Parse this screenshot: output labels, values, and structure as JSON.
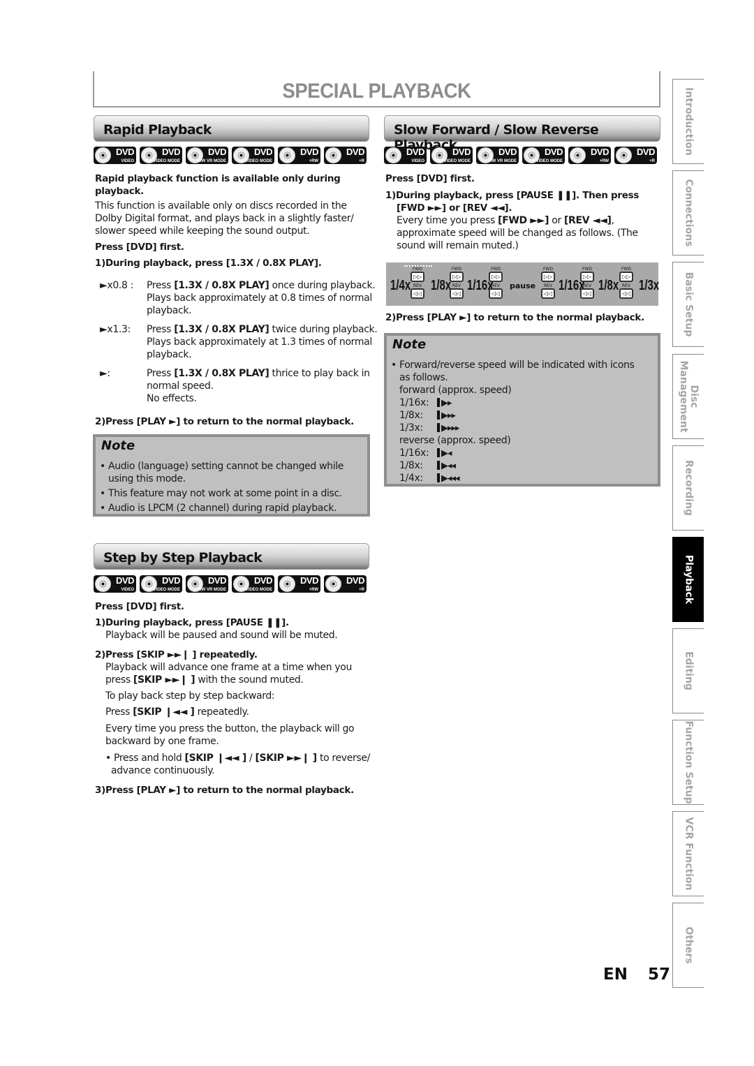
{
  "page": {
    "title": "SPECIAL PLAYBACK",
    "lang_code": "EN",
    "page_number": "57"
  },
  "disc_icons": [
    {
      "name": "DVD",
      "sub": "VIDEO"
    },
    {
      "name": "DVD",
      "sub": "-RW VIDEO MODE"
    },
    {
      "name": "DVD",
      "sub": "-RW VR MODE"
    },
    {
      "name": "DVD",
      "sub": "-R VIDEO MODE"
    },
    {
      "name": "DVD",
      "sub": "+RW"
    },
    {
      "name": "DVD",
      "sub": "+R"
    }
  ],
  "rapid": {
    "header": "Rapid Playback",
    "intro_bold_1": "Rapid playback function is available only during",
    "intro_bold_2": "playback.",
    "desc_1": "This function is available only on discs recorded in the",
    "desc_2": "Dolby Digital format, and plays back in a slightly faster/",
    "desc_3": "slower speed while keeping the sound output.",
    "press_first": "Press [DVD] first.",
    "step1": "1)During playback, press [1.3X / 0.8X PLAY].",
    "modes": [
      {
        "key": "►x0.8 :",
        "pre": "Press ",
        "btn": "[1.3X / 0.8X PLAY]",
        "post": " once during playback.",
        "l2": "Plays back approximately at 0.8 times of normal",
        "l3": "playback."
      },
      {
        "key": "►x1.3:",
        "pre": "Press ",
        "btn": "[1.3X / 0.8X PLAY]",
        "post": " twice during playback.",
        "l2": "Plays back approximately at 1.3 times of normal",
        "l3": "playback."
      },
      {
        "key": "►:",
        "pre": "Press ",
        "btn": "[1.3X / 0.8X PLAY]",
        "post": " thrice to play back in",
        "l2": "normal speed.",
        "l3": "No effects."
      }
    ],
    "step2": "2)Press [PLAY ►] to return to the normal playback.",
    "note_title": "Note",
    "notes": [
      "Audio (language) setting cannot be changed while",
      "using this mode.",
      "This feature may not work at some point in a disc.",
      "Audio is LPCM (2 channel) during rapid playback."
    ]
  },
  "slow": {
    "header": "Slow Forward / Slow Reverse Playback",
    "press_first": "Press [DVD] first.",
    "step1_a": "1)During playback, press [PAUSE ❚❚]. Then press",
    "step1_b": "[FWD ►►] or [REV ◄◄].",
    "desc_pre": "Every time you press ",
    "desc_fwd": "[FWD ►►]",
    "desc_or": " or ",
    "desc_rev": "[REV ◄◄]",
    "desc_comma": ",",
    "desc_2": "approximate speed will be changed as follows. (The",
    "desc_3": "sound will remain muted.)",
    "diagram": {
      "speeds": [
        "1/4x",
        "1/8x",
        "1/16x",
        "pause",
        "1/16x",
        "1/8x",
        "1/3x"
      ],
      "fwd_label": "FWD",
      "rev_label": "REV",
      "fwd_glyph": "▷▷",
      "rev_glyph": "◁◁"
    },
    "step2": "2)Press [PLAY ►] to return to the normal playback.",
    "note_title": "Note",
    "note_line1": "Forward/reverse speed will be indicated with icons",
    "note_line2": "as follows.",
    "forward_label": "forward (approx. speed)",
    "forward_speeds": [
      {
        "label": "1/16x:",
        "icon": "▶▸"
      },
      {
        "label": "1/8x:",
        "icon": "▶▸▸"
      },
      {
        "label": "1/3x:",
        "icon": "▶▸▸▸"
      }
    ],
    "reverse_label": "reverse (approx. speed)",
    "reverse_speeds": [
      {
        "label": "1/16x:",
        "icon": "▶◂"
      },
      {
        "label": "1/8x:",
        "icon": "▶◂◂"
      },
      {
        "label": "1/4x:",
        "icon": "▶◂◂◂"
      }
    ]
  },
  "step": {
    "header": "Step by Step Playback",
    "press_first": "Press [DVD] first.",
    "step1": "1)During playback, press [PAUSE ❚❚].",
    "step1_desc": "Playback will be paused and sound will be muted.",
    "step2": "2)Press [SKIP ►►❙ ] repeatedly.",
    "step2_desc1": "Playback will advance one frame at a time when you",
    "step2_desc2_pre": "press ",
    "step2_desc2_btn": "[SKIP ►►❙ ]",
    "step2_desc2_post": " with the sound muted.",
    "backward_intro": "To play back step by step backward:",
    "backward_pre": "Press ",
    "backward_btn": "[SKIP ❙◄◄ ]",
    "backward_post": " repeatedly.",
    "every_1": "Every time you press the button, the playback will go",
    "every_2": "backward by one frame.",
    "hold_pre": "Press and hold ",
    "hold_btn1": "[SKIP ❙◄◄ ]",
    "hold_mid": " / ",
    "hold_btn2": "[SKIP ►►❙ ]",
    "hold_post": " to reverse/",
    "hold_2": "advance continuously.",
    "step3": "3)Press [PLAY ►] to return to the normal playback."
  },
  "side_tabs": [
    {
      "label": "Introduction",
      "active": false
    },
    {
      "label": "Connections",
      "active": false
    },
    {
      "label": "Basic Setup",
      "active": false
    },
    {
      "label": "Disc Management",
      "active": false
    },
    {
      "label": "Recording",
      "active": false
    },
    {
      "label": "Playback",
      "active": true
    },
    {
      "label": "Editing",
      "active": false
    },
    {
      "label": "Function Setup",
      "active": false
    },
    {
      "label": "VCR Function",
      "active": false
    },
    {
      "label": "Others",
      "active": false
    }
  ]
}
